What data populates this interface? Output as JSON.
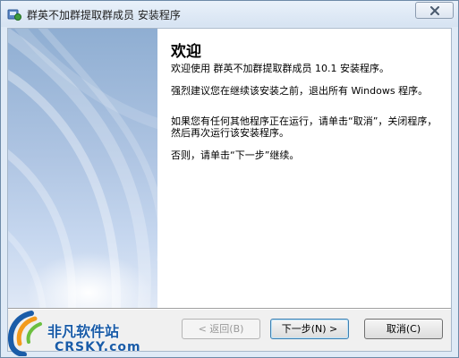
{
  "window": {
    "title": "群英不加群提取群成员 安装程序"
  },
  "wizard": {
    "heading": "欢迎",
    "paragraphs": [
      "欢迎使用 群英不加群提取群成员 10.1 安装程序。",
      "强烈建议您在继续该安装之前，退出所有 Windows 程序。",
      "如果您有任何其他程序正在运行，请单击“取消”，关闭程序，然后再次运行该安装程序。",
      "否则，请单击“下一步”继续。"
    ]
  },
  "buttons": {
    "back_label": "< 返回(B)",
    "next_label": "下一步(N) >",
    "cancel_label": "取消(C)"
  },
  "watermark": {
    "cn": "非凡软件站",
    "en": "CRSKY.com"
  },
  "colors": {
    "accent": "#3c7fb1",
    "side_panel": "#aec4e2",
    "watermark": "#1a5ca8"
  },
  "icons": {
    "app": "installer-icon",
    "close": "close-icon"
  }
}
